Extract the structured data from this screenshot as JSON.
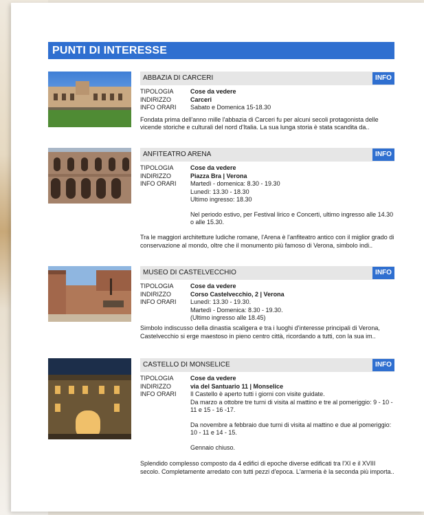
{
  "section_title": "PUNTI DI INTERESSE",
  "labels": {
    "tipologia": "TIPOLOGIA",
    "indirizzo": "INDIRIZZO",
    "info_orari": "INFO ORARI",
    "info_button": "INFO"
  },
  "items": [
    {
      "name": "ABBAZIA DI CARCERI",
      "tipologia": "Cose da vedere",
      "indirizzo": "Carceri",
      "orari": [
        "Sabato e Domenica 15-18.30"
      ],
      "description": "Fondata prima dell'anno mille l'abbazia di Carceri fu per alcuni secoli protagonista delle vicende storiche e culturali del nord d'Italia. La sua lunga storia è stata scandita da.."
    },
    {
      "name": "ANFITEATRO ARENA",
      "tipologia": "Cose da vedere",
      "indirizzo": "Piazza Bra | Verona",
      "orari": [
        "Martedì - domenica: 8.30 - 19.30",
        "Lunedì: 13.30 - 18.30",
        "Ultimo ingresso: 18.30"
      ],
      "note": "Nel periodo estivo, per Festival lirico e Concerti, ultimo ingresso alle 14.30 o alle 15.30.",
      "description": "Tra le maggiori architetture ludiche romane, l'Arena è l'anfiteatro antico con il miglior grado di conservazione al mondo, oltre che il monumento più famoso di Verona, simbolo indi.."
    },
    {
      "name": "MUSEO DI CASTELVECCHIO",
      "tipologia": "Cose da vedere",
      "indirizzo": "Corso Castelvecchio, 2 | Verona",
      "orari": [
        "Lunedì: 13.30 - 19.30.",
        "Martedì - Domenica: 8.30 - 19.30.",
        "(Ultimo ingresso alle 18.45)"
      ],
      "description": "Simbolo indiscusso della dinastia scaligera e tra i luoghi d'interesse principali di Verona, Castelvecchio si erge maestoso in pieno centro città, ricordando a tutti, con la sua im.."
    },
    {
      "name": "CASTELLO DI MONSELICE",
      "tipologia": "Cose da vedere",
      "indirizzo": "via del Santuario 11 | Monselice",
      "orari": [
        "Il Castello è aperto tutti i giorni con visite guidate.",
        "Da marzo a ottobre tre turni di visita al mattino e tre al pomeriggio: 9 - 10 - 11 e 15 - 16 -17."
      ],
      "note": "Da novembre a febbraio due turni di visita al mattino e due al pomeriggio:  10 - 11 e 14 - 15.",
      "note2": "Gennaio chiuso.",
      "description": "Splendido complesso composto da 4 edifici di epoche diverse edificati tra l'XI e il XVIII secolo. Completamente arredato con tutti pezzi d'epoca. L'armeria è la seconda più importa.."
    }
  ]
}
